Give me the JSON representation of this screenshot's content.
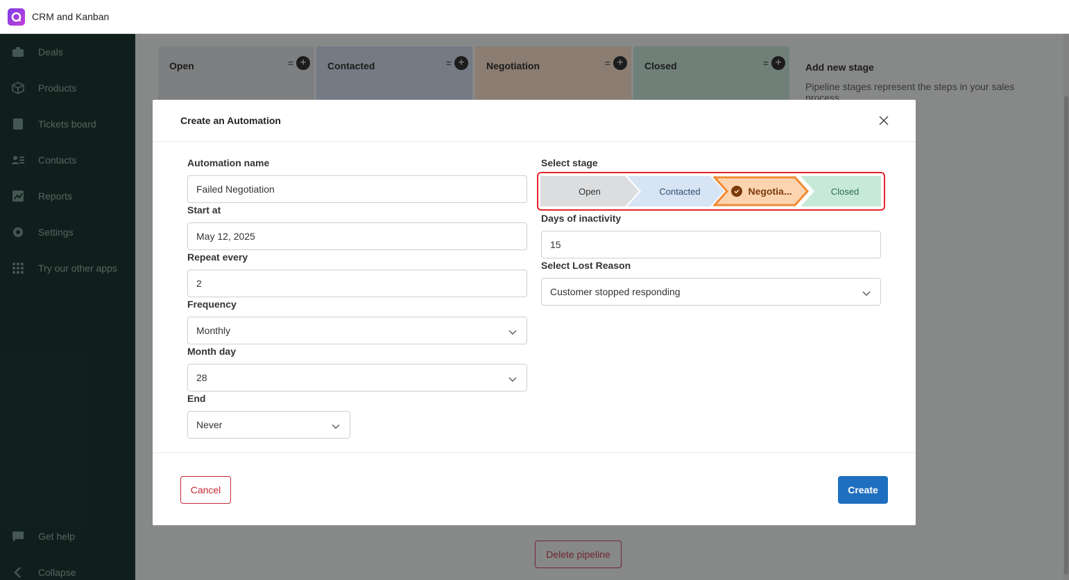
{
  "app": {
    "title": "CRM and Kanban"
  },
  "sidebar": {
    "items": [
      {
        "label": "Deals",
        "icon": "deals-icon"
      },
      {
        "label": "Products",
        "icon": "box-icon"
      },
      {
        "label": "Tickets board",
        "icon": "board-icon"
      },
      {
        "label": "Contacts",
        "icon": "contacts-icon"
      },
      {
        "label": "Reports",
        "icon": "chart-icon"
      },
      {
        "label": "Settings",
        "icon": "gear-icon"
      },
      {
        "label": "Try our other apps",
        "icon": "grid-icon"
      }
    ],
    "bottom": [
      {
        "label": "Get help",
        "icon": "chat-icon"
      },
      {
        "label": "Collapse",
        "icon": "chevron-left-icon"
      }
    ]
  },
  "board": {
    "columns": [
      {
        "name": "Open",
        "color": "#e6e7e9"
      },
      {
        "name": "Contacted",
        "color": "#d3e1f1"
      },
      {
        "name": "Negotiation",
        "color": "#fde4cf"
      },
      {
        "name": "Closed",
        "color": "#cde9dc"
      }
    ],
    "add_stage": {
      "title": "Add new stage",
      "text": "Pipeline stages represent the steps in your sales process"
    },
    "delete_pipeline": "Delete pipeline"
  },
  "modal": {
    "title": "Create an Automation",
    "automation_name": {
      "label": "Automation name",
      "value": "Failed Negotiation"
    },
    "start_at": {
      "label": "Start at",
      "value": "May 12, 2025"
    },
    "repeat_every": {
      "label": "Repeat every",
      "value": "2"
    },
    "frequency": {
      "label": "Frequency",
      "value": "Monthly"
    },
    "month_day": {
      "label": "Month day",
      "value": "28"
    },
    "end": {
      "label": "End",
      "value": "Never"
    },
    "select_stage": {
      "label": "Select stage",
      "stages": [
        {
          "name": "Open",
          "fill": "#dcdddf",
          "text": "#333333",
          "selected": false
        },
        {
          "name": "Contacted",
          "fill": "#d6e4f4",
          "text": "#2f4d6d",
          "selected": false
        },
        {
          "name": "Negotia...",
          "fill": "#fcd4b0",
          "text": "#7a3b0b",
          "selected": true
        },
        {
          "name": "Closed",
          "fill": "#c6ead7",
          "text": "#2a6b48",
          "selected": false
        }
      ]
    },
    "days_inactivity": {
      "label": "Days of inactivity",
      "value": "15"
    },
    "lost_reason": {
      "label": "Select Lost Reason",
      "value": "Customer stopped responding"
    },
    "cancel_label": "Cancel",
    "create_label": "Create"
  }
}
